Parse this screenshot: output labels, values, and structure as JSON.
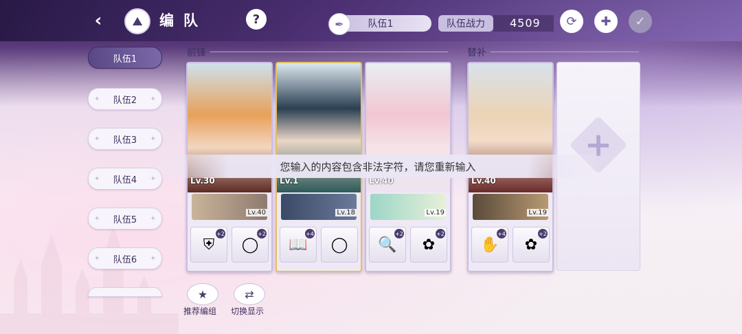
{
  "header": {
    "title": "编队",
    "team_name": "队伍1",
    "power_label": "队伍战力",
    "power_value": "4509"
  },
  "team_tabs": [
    "队伍1",
    "队伍2",
    "队伍3",
    "队伍4",
    "队伍5",
    "队伍6"
  ],
  "sections": {
    "front": "前锋",
    "substitute": "替补"
  },
  "cards": [
    {
      "level": "Lv.30",
      "support_level": "Lv.40",
      "equip": [
        "shield-icon",
        "ring-icon"
      ],
      "equip_badges": [
        "+2",
        "+2"
      ]
    },
    {
      "level": "Lv.1",
      "support_level": "Lv.18",
      "equip": [
        "book-icon",
        "ring-icon"
      ],
      "equip_badges": [
        "+4",
        ""
      ]
    },
    {
      "level": "Lv.40",
      "support_level": "Lv.19",
      "equip": [
        "magnifier-icon",
        "earring-icon"
      ],
      "equip_badges": [
        "+2",
        "+2"
      ]
    },
    {
      "level": "Lv.40",
      "support_level": "Lv.19",
      "equip": [
        "gauntlet-icon",
        "earring-icon"
      ],
      "equip_badges": [
        "+4",
        "+2"
      ]
    }
  ],
  "toast": "您输入的内容包含非法字符，请您重新输入",
  "bottom_buttons": {
    "recommend": "推荐编组",
    "switch": "切换显示"
  }
}
